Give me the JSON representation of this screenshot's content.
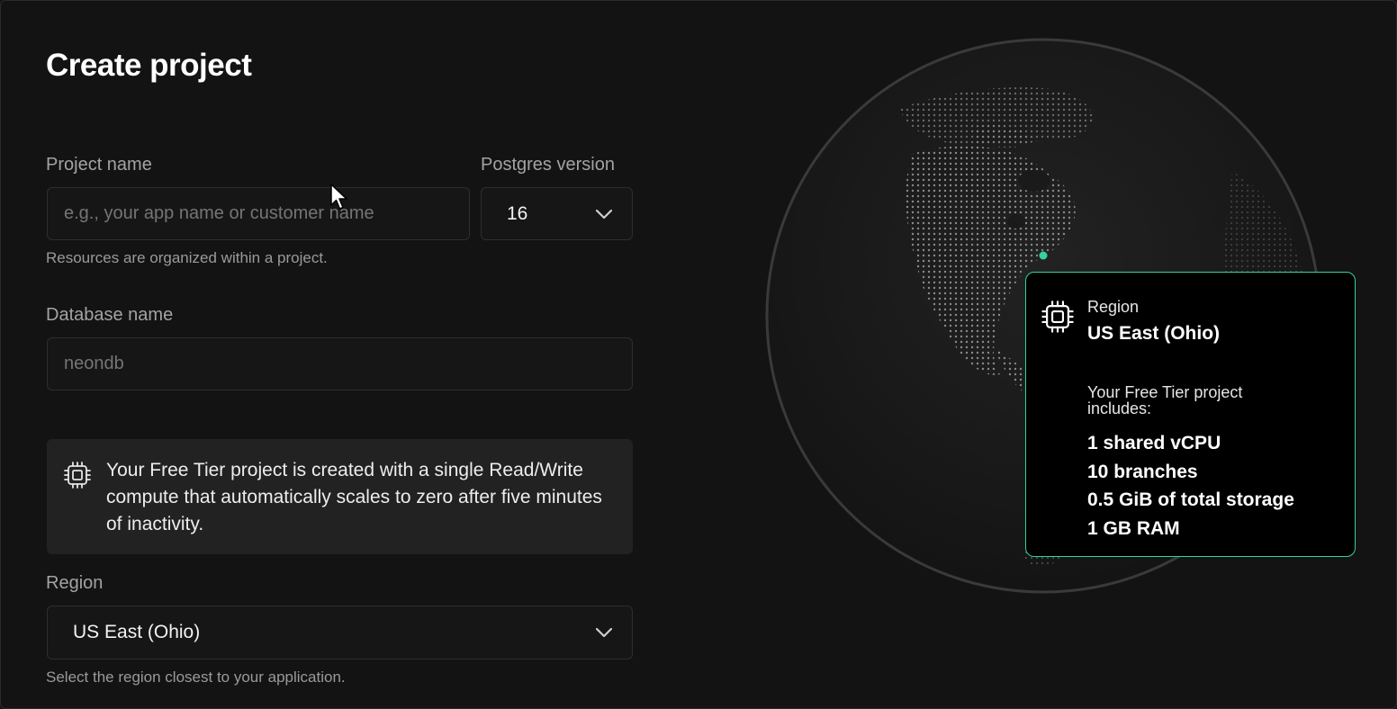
{
  "page": {
    "title": "Create project"
  },
  "form": {
    "project_name": {
      "label": "Project name",
      "placeholder": "e.g., your app name or customer name",
      "value": "",
      "hint": "Resources are organized within a project."
    },
    "postgres_version": {
      "label": "Postgres version",
      "selected": "16"
    },
    "database_name": {
      "label": "Database name",
      "placeholder": "neondb",
      "value": ""
    },
    "info_box": {
      "icon": "cpu-chip-icon",
      "text": "Your Free Tier project is created with a single Read/Write compute that automatically scales to zero after five minutes of inactivity."
    },
    "region": {
      "label": "Region",
      "selected": "US East (Ohio)",
      "hint": "Select the region closest to your application."
    }
  },
  "tooltip": {
    "icon": "cpu-chip-icon",
    "label": "Region",
    "region": "US East (Ohio)",
    "includes_label": "Your Free Tier project includes:",
    "features": [
      "1 shared vCPU",
      "10 branches",
      "0.5 GiB of total storage",
      "1 GB RAM"
    ]
  },
  "colors": {
    "background": "#131313",
    "input_bg": "#161616",
    "border": "#2e2e2e",
    "info_bg": "#222222",
    "accent_green": "#34d399",
    "muted_text": "#a3a3a3"
  },
  "globe": {
    "marker_label": "US East (Ohio)",
    "marker_color": "#34d399"
  }
}
